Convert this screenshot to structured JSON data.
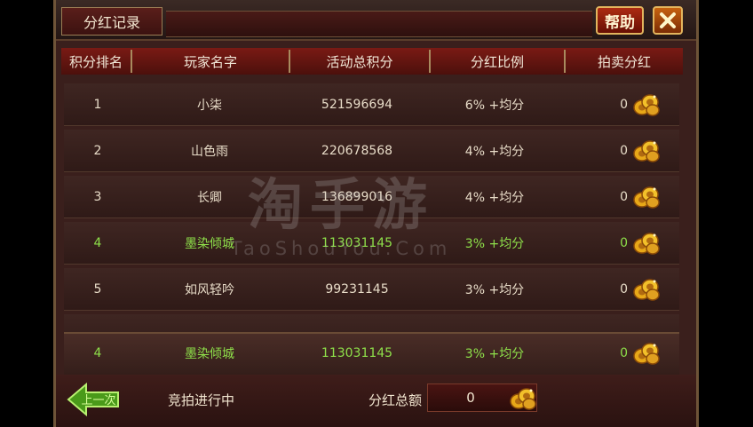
{
  "window": {
    "title": "分红记录",
    "help_label": "帮助",
    "close_icon": "close-x-icon"
  },
  "table": {
    "columns": [
      "积分排名",
      "玩家名字",
      "活动总积分",
      "分红比例",
      "拍卖分红"
    ],
    "rows": [
      {
        "rank": "1",
        "name": "小柒",
        "score": "521596694",
        "ratio": "6% +均分",
        "auction": "0",
        "highlight": false
      },
      {
        "rank": "2",
        "name": "山色雨",
        "score": "220678568",
        "ratio": "4% +均分",
        "auction": "0",
        "highlight": false
      },
      {
        "rank": "3",
        "name": "长卿",
        "score": "136899016",
        "ratio": "4% +均分",
        "auction": "0",
        "highlight": false
      },
      {
        "rank": "4",
        "name": "墨染倾城",
        "score": "113031145",
        "ratio": "3% +均分",
        "auction": "0",
        "highlight": true
      },
      {
        "rank": "5",
        "name": "如风轻吟",
        "score": "99231145",
        "ratio": "3% +均分",
        "auction": "0",
        "highlight": false
      }
    ],
    "self_row": {
      "rank": "4",
      "name": "墨染倾城",
      "score": "113031145",
      "ratio": "3% +均分",
      "auction": "0"
    }
  },
  "footer": {
    "prev_label": "上一次",
    "status": "竞拍进行中",
    "total_label": "分红总额",
    "total_value": "0"
  },
  "watermark": {
    "line1": "淘手游",
    "line2": "TaoShouYou.Com"
  },
  "colors": {
    "highlight": "#8ee04a",
    "header": "#7a1a14",
    "gold": "#e8a818"
  }
}
